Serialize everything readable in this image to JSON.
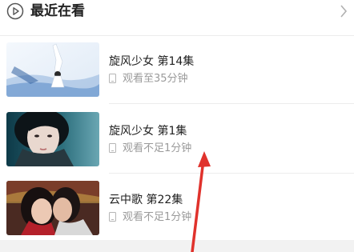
{
  "header": {
    "title": "最近在看",
    "play_icon": "play-circle-icon",
    "more_icon": "chevron-right-icon"
  },
  "items": [
    {
      "title": "旋风少女 第14集",
      "progress": "观看至35分钟",
      "device_icon": "phone-icon"
    },
    {
      "title": "旋风少女 第1集",
      "progress": "观看不足1分钟",
      "device_icon": "phone-icon"
    },
    {
      "title": "云中歌 第22集",
      "progress": "观看不足1分钟",
      "device_icon": "phone-icon"
    }
  ],
  "annotation": {
    "color": "#e0322c"
  }
}
